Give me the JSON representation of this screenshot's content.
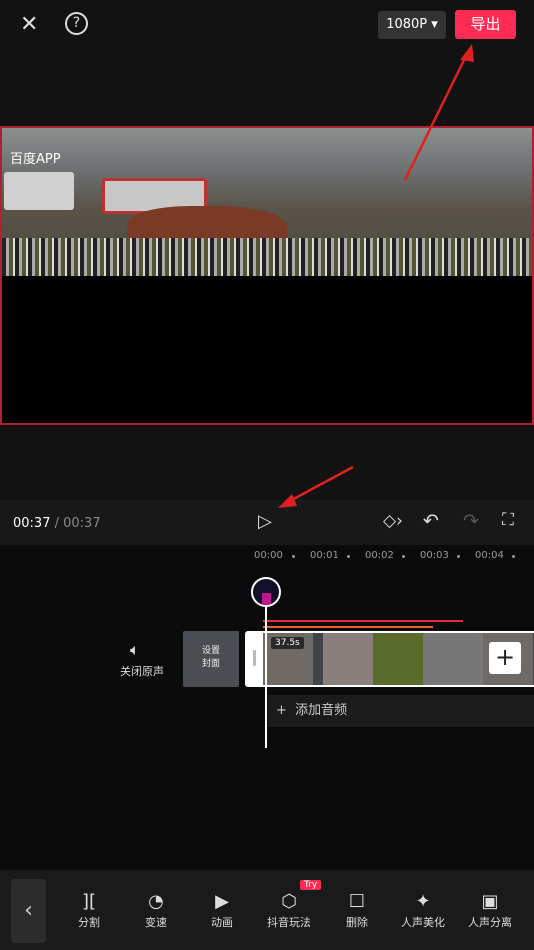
{
  "topbar": {
    "resolution": "1080P",
    "export_label": "导出"
  },
  "preview": {
    "watermark": "百度APP"
  },
  "controls": {
    "current_time": "00:37",
    "total_time": "00:37"
  },
  "timeline": {
    "ruler": [
      "00:00",
      "00:01",
      "00:02",
      "00:03",
      "00:04"
    ],
    "mute_label": "关闭原声",
    "cover_label_1": "设置",
    "cover_label_2": "封面",
    "clip_duration": "37.5s",
    "add_audio_label": "添加音频"
  },
  "toolbar": {
    "items": [
      {
        "label": "分割",
        "icon": "split-icon"
      },
      {
        "label": "变速",
        "icon": "speed-icon"
      },
      {
        "label": "动画",
        "icon": "animation-icon"
      },
      {
        "label": "抖音玩法",
        "icon": "cube-icon"
      },
      {
        "label": "删除",
        "icon": "delete-icon"
      },
      {
        "label": "人声美化",
        "icon": "voice-beautify-icon"
      },
      {
        "label": "人声分离",
        "icon": "voice-separate-icon"
      }
    ],
    "try_badge": "Try"
  },
  "colors": {
    "accent": "#fe2c55",
    "annotation_arrow": "#e02020"
  }
}
